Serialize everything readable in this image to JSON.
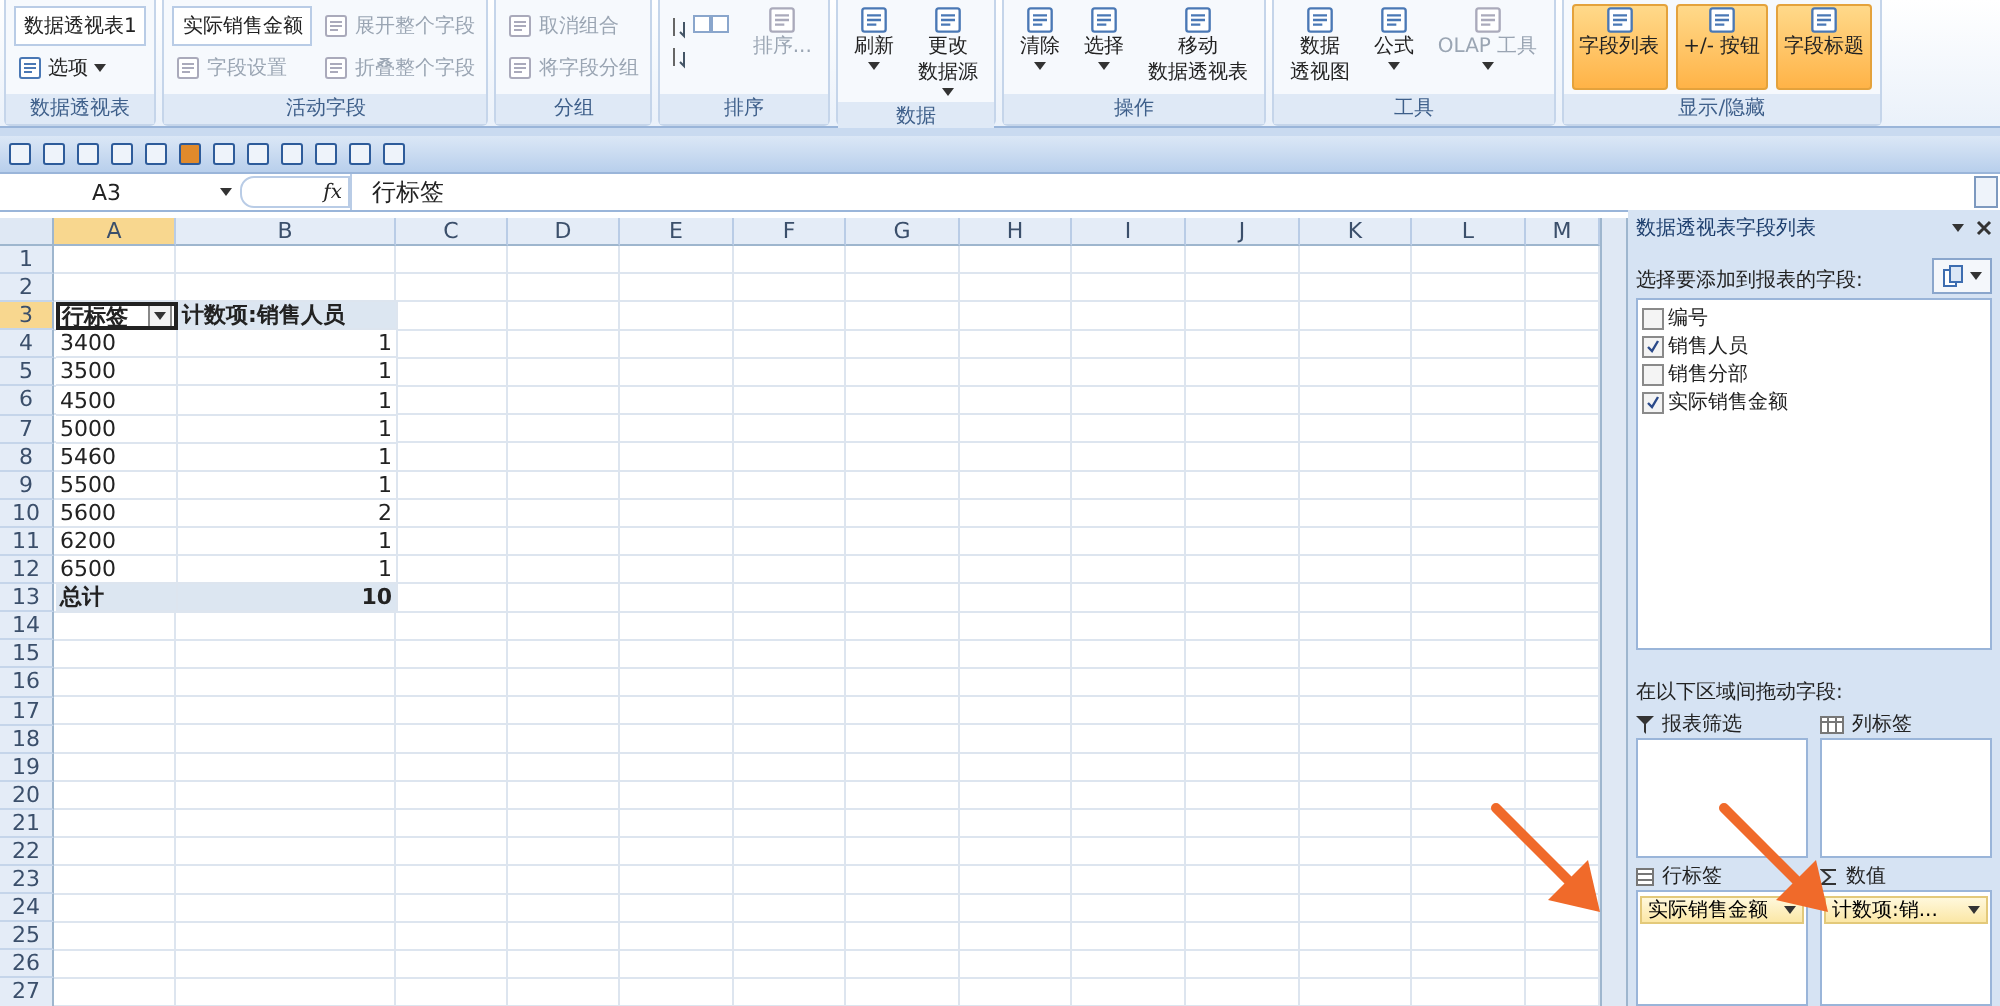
{
  "ribbon": {
    "groups": [
      {
        "label": "数据透视表",
        "items": [
          {
            "kind": "field",
            "label": "数据透视表1"
          },
          {
            "kind": "small",
            "label": "选项",
            "dropdown": true,
            "disabled": false
          }
        ]
      },
      {
        "label": "活动字段",
        "items": [
          {
            "kind": "field",
            "label": "实际销售金额"
          },
          {
            "kind": "small",
            "label": "字段设置",
            "disabled": true
          },
          {
            "kind": "small",
            "label": "展开整个字段",
            "disabled": true
          },
          {
            "kind": "small",
            "label": "折叠整个字段",
            "disabled": true
          }
        ]
      },
      {
        "label": "分组",
        "items": [
          {
            "kind": "small",
            "label": "取消组合",
            "disabled": true
          },
          {
            "kind": "small",
            "label": "将字段分组",
            "disabled": true
          }
        ]
      },
      {
        "label": "排序",
        "items": [
          {
            "kind": "sort"
          },
          {
            "kind": "large",
            "lines": [
              "排序..."
            ],
            "disabled": true
          }
        ]
      },
      {
        "label": "数据",
        "items": [
          {
            "kind": "large",
            "lines": [
              "刷新"
            ],
            "dropdown": true,
            "disabled": false
          },
          {
            "kind": "large",
            "lines": [
              "更改",
              "数据源"
            ],
            "dropdown": true,
            "disabled": false
          }
        ]
      },
      {
        "label": "操作",
        "items": [
          {
            "kind": "large",
            "lines": [
              "清除"
            ],
            "dropdown": true,
            "disabled": false
          },
          {
            "kind": "large",
            "lines": [
              "选择"
            ],
            "dropdown": true,
            "disabled": false
          },
          {
            "kind": "large",
            "lines": [
              "移动",
              "数据透视表"
            ],
            "disabled": false
          }
        ]
      },
      {
        "label": "工具",
        "items": [
          {
            "kind": "large",
            "lines": [
              "数据",
              "透视图"
            ],
            "disabled": false
          },
          {
            "kind": "large",
            "lines": [
              "公式"
            ],
            "dropdown": true,
            "disabled": false
          },
          {
            "kind": "large",
            "lines": [
              "OLAP 工具"
            ],
            "dropdown": true,
            "disabled": true
          }
        ]
      },
      {
        "label": "显示/隐藏",
        "items": [
          {
            "kind": "toggle",
            "lines": [
              "字段列表"
            ],
            "on": true
          },
          {
            "kind": "toggle",
            "lines": [
              "+/- 按钮"
            ],
            "on": true
          },
          {
            "kind": "toggle",
            "lines": [
              "字段标题"
            ],
            "on": true
          }
        ]
      }
    ]
  },
  "formula_bar": {
    "name_box": "A3",
    "fx": "fx",
    "value": "行标签"
  },
  "sheet": {
    "columns": [
      {
        "label": "A",
        "selected": true
      },
      {
        "label": "B",
        "selected": false
      },
      {
        "label": "C",
        "selected": false
      },
      {
        "label": "D",
        "selected": false
      },
      {
        "label": "E",
        "selected": false
      },
      {
        "label": "F",
        "selected": false
      },
      {
        "label": "G",
        "selected": false
      },
      {
        "label": "H",
        "selected": false
      },
      {
        "label": "I",
        "selected": false
      },
      {
        "label": "J",
        "selected": false
      },
      {
        "label": "K",
        "selected": false
      },
      {
        "label": "L",
        "selected": false
      },
      {
        "label": "M",
        "selected": false
      }
    ],
    "rows": [
      {
        "label": "1",
        "selected": false
      },
      {
        "label": "2",
        "selected": false
      },
      {
        "label": "3",
        "selected": true
      },
      {
        "label": "4",
        "selected": false
      },
      {
        "label": "5",
        "selected": false
      },
      {
        "label": "6",
        "selected": false
      },
      {
        "label": "7",
        "selected": false
      },
      {
        "label": "8",
        "selected": false
      },
      {
        "label": "9",
        "selected": false
      },
      {
        "label": "10",
        "selected": false
      },
      {
        "label": "11",
        "selected": false
      },
      {
        "label": "12",
        "selected": false
      },
      {
        "label": "13",
        "selected": false
      },
      {
        "label": "14",
        "selected": false
      },
      {
        "label": "15",
        "selected": false
      },
      {
        "label": "16",
        "selected": false
      },
      {
        "label": "17",
        "selected": false
      },
      {
        "label": "18",
        "selected": false
      },
      {
        "label": "19",
        "selected": false
      },
      {
        "label": "20",
        "selected": false
      },
      {
        "label": "21",
        "selected": false
      },
      {
        "label": "22",
        "selected": false
      },
      {
        "label": "23",
        "selected": false
      },
      {
        "label": "24",
        "selected": false
      },
      {
        "label": "25",
        "selected": false
      },
      {
        "label": "26",
        "selected": false
      },
      {
        "label": "27",
        "selected": false
      }
    ],
    "pivot": {
      "row_header": "行标签",
      "value_header": "计数项:销售人员",
      "rows": [
        {
          "label": "3400",
          "value": "1"
        },
        {
          "label": "3500",
          "value": "1"
        },
        {
          "label": "4500",
          "value": "1"
        },
        {
          "label": "5000",
          "value": "1"
        },
        {
          "label": "5460",
          "value": "1"
        },
        {
          "label": "5500",
          "value": "1"
        },
        {
          "label": "5600",
          "value": "2"
        },
        {
          "label": "6200",
          "value": "1"
        },
        {
          "label": "6500",
          "value": "1"
        }
      ],
      "total": {
        "label": "总计",
        "value": "10"
      }
    }
  },
  "field_list": {
    "title": "数据透视表字段列表",
    "prompt": "选择要添加到报表的字段:",
    "fields": [
      {
        "label": "编号",
        "checked": false
      },
      {
        "label": "销售人员",
        "checked": true
      },
      {
        "label": "销售分部",
        "checked": false
      },
      {
        "label": "实际销售金额",
        "checked": true
      }
    ],
    "areas_prompt": "在以下区域间拖动字段:",
    "areas": [
      {
        "kind": "filter",
        "label": "报表筛选"
      },
      {
        "kind": "columns",
        "label": "列标签"
      },
      {
        "kind": "rows",
        "label": "行标签",
        "fields": [
          "实际销售金额"
        ]
      },
      {
        "kind": "values",
        "label": "数值",
        "fields": [
          "计数项:销..."
        ]
      }
    ]
  },
  "annotations": [
    {
      "kind": "arrow"
    },
    {
      "kind": "arrow"
    }
  ]
}
